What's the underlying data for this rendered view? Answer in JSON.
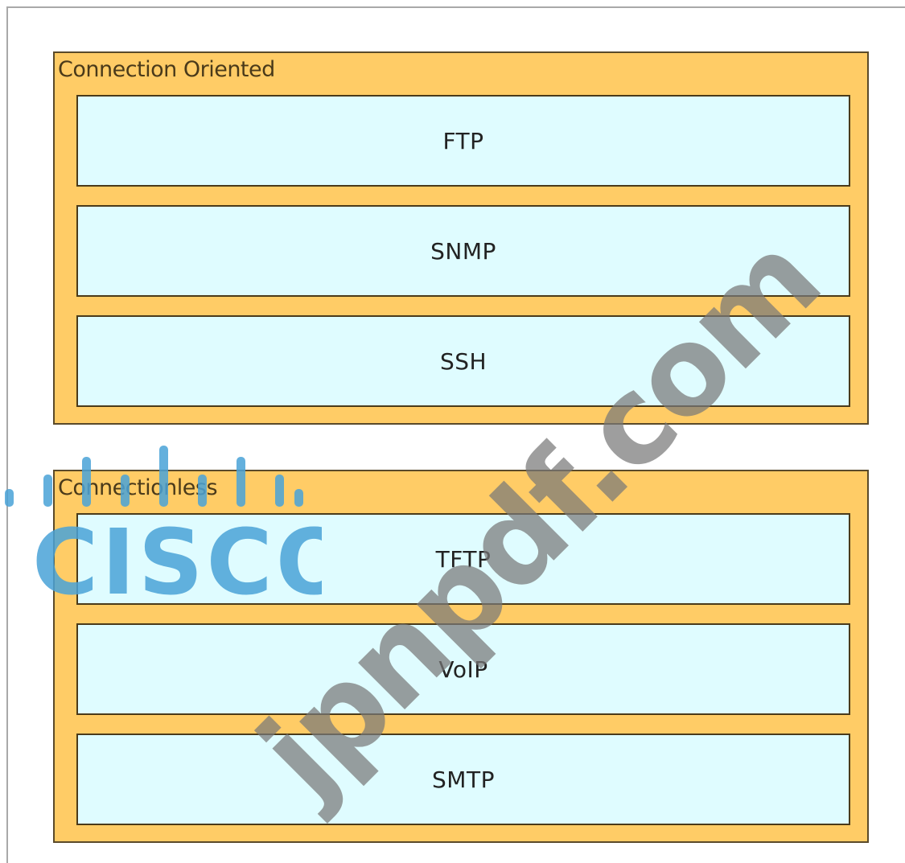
{
  "groups": [
    {
      "title": "Connection Oriented",
      "items": [
        "FTP",
        "SNMP",
        "SSH"
      ]
    },
    {
      "title": "Connectionless",
      "items": [
        "TFTP",
        "VoIP",
        "SMTP"
      ]
    }
  ],
  "watermark": {
    "logo_text": "CISCO",
    "site_text": "jpnpdf.com"
  },
  "colors": {
    "group_background": "#ffcc66",
    "slot_background": "#dffcff",
    "logo_blue": "#4aa3d8",
    "watermark_gray": "#787878"
  }
}
